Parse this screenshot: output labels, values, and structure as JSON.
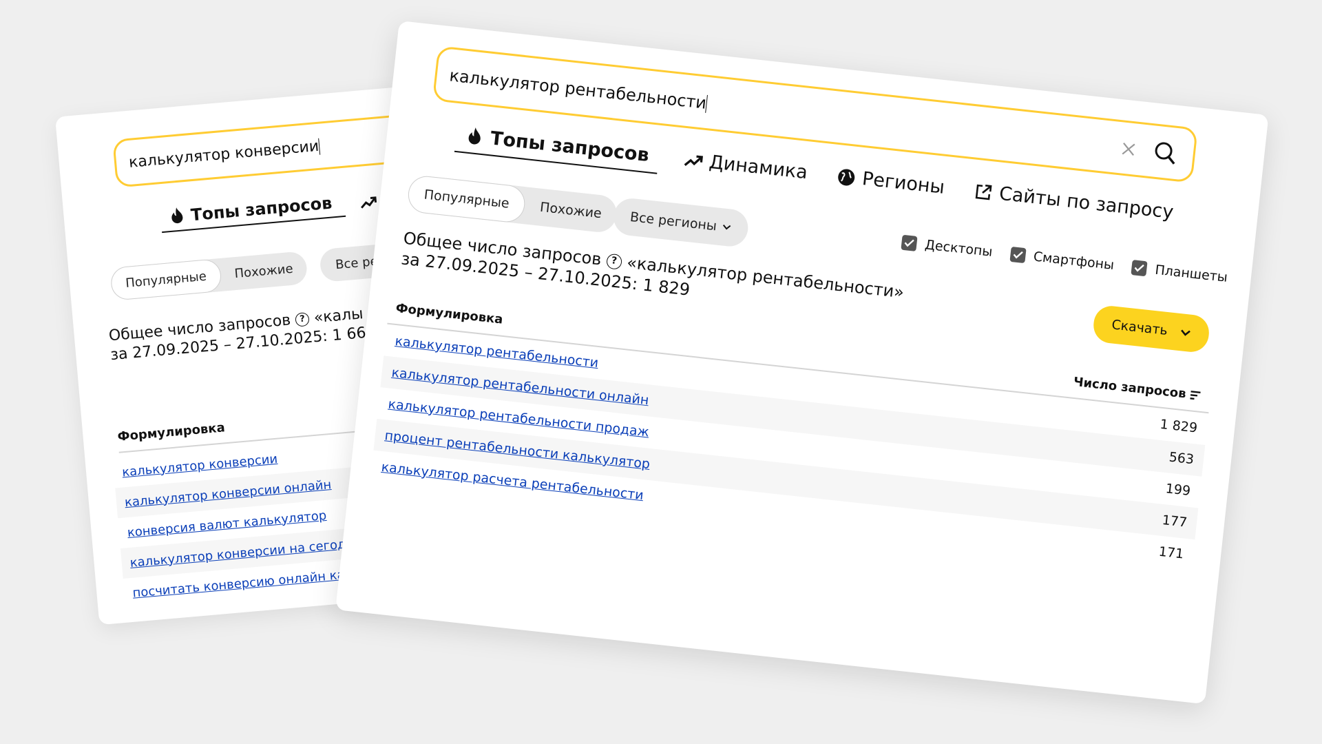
{
  "back_card": {
    "search": {
      "value": "калькулятор конверсии"
    },
    "tabs": [
      {
        "label": "Топы запросов",
        "icon": "flame-icon",
        "active": true
      }
    ],
    "segment": {
      "options": [
        "Популярные",
        "Похожие"
      ],
      "selected": "Популярные"
    },
    "region_pill": "Все ре",
    "total": {
      "line1_prefix": "Общее число запросов",
      "line1_quote": "«калы",
      "line2": "за 27.09.2025 – 27.10.2025: 1 66"
    },
    "table": {
      "col_phrase": "Формулировка",
      "rows": [
        "калькулятор конверсии",
        "калькулятор конверсии онлайн",
        "конверсия валют калькулятор",
        "калькулятор конверсии на сегодня",
        "посчитать конверсию онлайн калькулятор"
      ]
    }
  },
  "front_card": {
    "search": {
      "value": "калькулятор рентабельности",
      "clear_icon": "close-icon",
      "search_icon": "search-icon"
    },
    "tabs": [
      {
        "label": "Топы запросов",
        "icon": "flame-icon",
        "active": true
      },
      {
        "label": "Динамика",
        "icon": "trend-up-icon",
        "active": false
      },
      {
        "label": "Регионы",
        "icon": "globe-icon",
        "active": false
      },
      {
        "label": "Сайты по запросу",
        "icon": "external-link-icon",
        "active": false
      }
    ],
    "segment": {
      "options": [
        "Популярные",
        "Похожие"
      ],
      "selected": "Популярные"
    },
    "region_pill": "Все регионы",
    "devices": [
      {
        "label": "Десктопы",
        "checked": true
      },
      {
        "label": "Смартфоны",
        "checked": true
      },
      {
        "label": "Планшеты",
        "checked": true
      }
    ],
    "total": {
      "line1_prefix": "Общее число запросов",
      "line1_quote": "«калькулятор рентабельности»",
      "line2": "за 27.09.2025 – 27.10.2025: 1 829"
    },
    "download_label": "Скачать",
    "table": {
      "col_phrase": "Формулировка",
      "col_count": "Число запросов",
      "rows": [
        {
          "phrase": "калькулятор рентабельности",
          "count": "1 829"
        },
        {
          "phrase": "калькулятор рентабельности онлайн",
          "count": "563"
        },
        {
          "phrase": "калькулятор рентабельности продаж",
          "count": "199"
        },
        {
          "phrase": "процент рентабельности калькулятор",
          "count": "177"
        },
        {
          "phrase": "калькулятор расчета рентабельности",
          "count": "171"
        }
      ]
    }
  },
  "colors": {
    "accent_yellow": "#fcd31f",
    "link_blue": "#0b3fb8"
  }
}
